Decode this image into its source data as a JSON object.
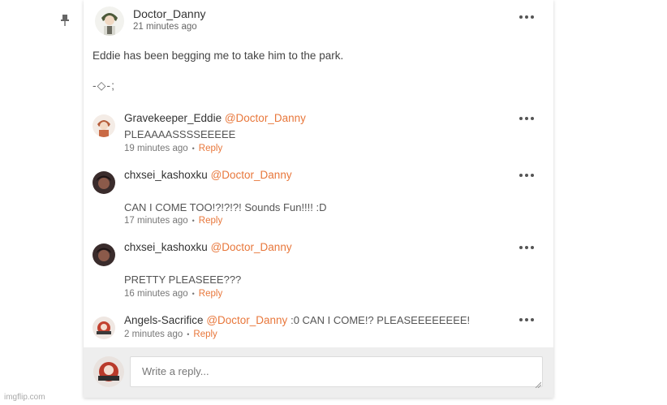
{
  "post": {
    "author": "Doctor_Danny",
    "time": "21 minutes ago",
    "body": "Eddie has been begging me to take him to the park.",
    "emote": "-◇-;"
  },
  "comments": [
    {
      "author": "Gravekeeper_Eddie",
      "mention": "@Doctor_Danny",
      "inline_text": "",
      "text": "PLEAAAASSSSEEEEE",
      "time": "19 minutes ago",
      "reply_label": "Reply"
    },
    {
      "author": "chxsei_kashoxku",
      "mention": "@Doctor_Danny",
      "inline_text": "",
      "text": "CAN I COME TOO!?!?!?! Sounds Fun!!!! :D",
      "time": "17 minutes ago",
      "reply_label": "Reply"
    },
    {
      "author": "chxsei_kashoxku",
      "mention": "@Doctor_Danny",
      "inline_text": "",
      "text": "PRETTY PLEASEEE???",
      "time": "16 minutes ago",
      "reply_label": "Reply"
    },
    {
      "author": "Angels-Sacrifice",
      "mention": "@Doctor_Danny",
      "inline_text": ":0 CAN I COME!? PLEASEEEEEEEE!",
      "text": "",
      "time": "2 minutes ago",
      "reply_label": "Reply"
    }
  ],
  "reply_box": {
    "placeholder": "Write a reply..."
  },
  "watermark": "imgflip.com",
  "colors": {
    "accent": "#e8773b",
    "reply_bar_bg": "#eeeeee"
  },
  "icons": [
    "pin-icon",
    "more-options-icon",
    "resize-grip-icon"
  ]
}
